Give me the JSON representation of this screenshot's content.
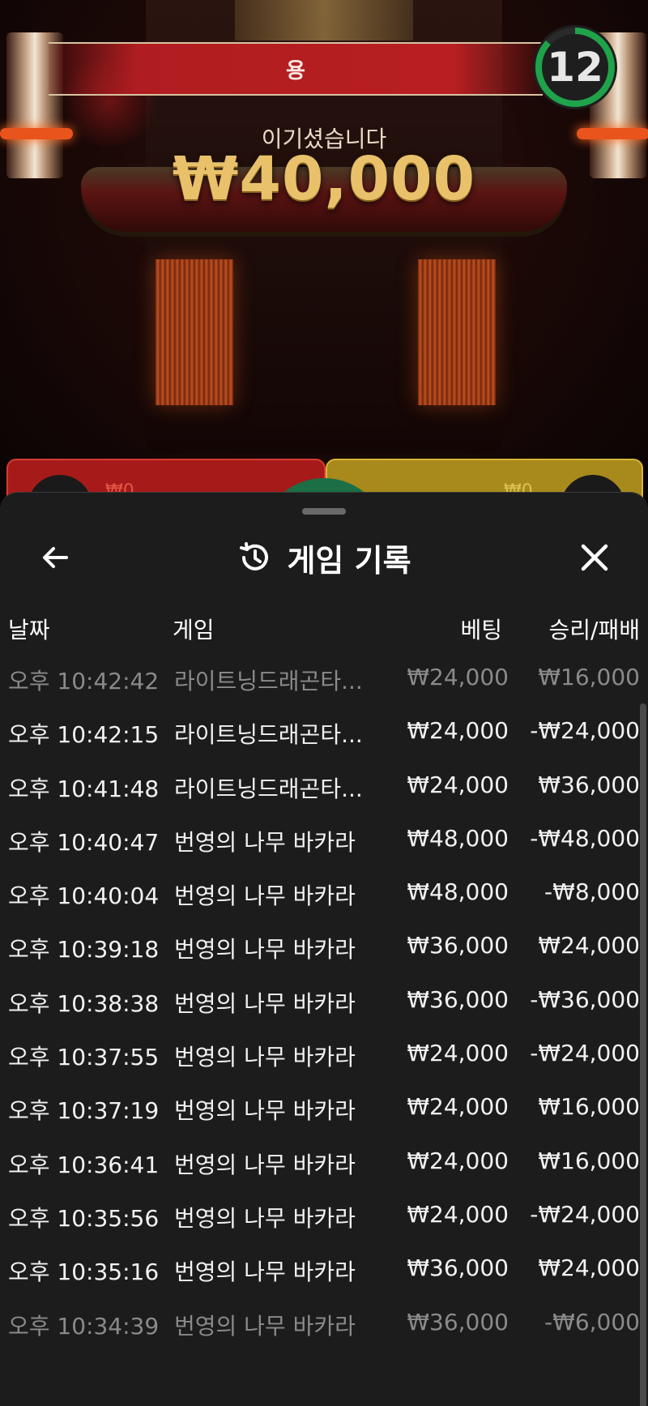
{
  "game_view": {
    "banner_label": "용",
    "timer_value": "12",
    "win_message": "이기셨습니다",
    "win_amount": "₩40,000",
    "red_bet": "₩0",
    "gold_bet": "₩0"
  },
  "sheet": {
    "title": "게임 기록",
    "columns": {
      "date": "날짜",
      "game": "게임",
      "bet": "베팅",
      "result": "승리/패배"
    },
    "rows": [
      {
        "date": "오후 10:42:42",
        "game": "라이트닝드래곤타...",
        "bet": "₩24,000",
        "result": "₩16,000"
      },
      {
        "date": "오후 10:42:15",
        "game": "라이트닝드래곤타...",
        "bet": "₩24,000",
        "result": "-₩24,000"
      },
      {
        "date": "오후 10:41:48",
        "game": "라이트닝드래곤타...",
        "bet": "₩24,000",
        "result": "₩36,000"
      },
      {
        "date": "오후 10:40:47",
        "game": "번영의 나무 바카라",
        "bet": "₩48,000",
        "result": "-₩48,000"
      },
      {
        "date": "오후 10:40:04",
        "game": "번영의 나무 바카라",
        "bet": "₩48,000",
        "result": "-₩8,000"
      },
      {
        "date": "오후 10:39:18",
        "game": "번영의 나무 바카라",
        "bet": "₩36,000",
        "result": "₩24,000"
      },
      {
        "date": "오후 10:38:38",
        "game": "번영의 나무 바카라",
        "bet": "₩36,000",
        "result": "-₩36,000"
      },
      {
        "date": "오후 10:37:55",
        "game": "번영의 나무 바카라",
        "bet": "₩24,000",
        "result": "-₩24,000"
      },
      {
        "date": "오후 10:37:19",
        "game": "번영의 나무 바카라",
        "bet": "₩24,000",
        "result": "₩16,000"
      },
      {
        "date": "오후 10:36:41",
        "game": "번영의 나무 바카라",
        "bet": "₩24,000",
        "result": "₩16,000"
      },
      {
        "date": "오후 10:35:56",
        "game": "번영의 나무 바카라",
        "bet": "₩24,000",
        "result": "-₩24,000"
      },
      {
        "date": "오후 10:35:16",
        "game": "번영의 나무 바카라",
        "bet": "₩36,000",
        "result": "₩24,000"
      },
      {
        "date": "오후 10:34:39",
        "game": "번영의 나무 바카라",
        "bet": "₩36,000",
        "result": "-₩6,000"
      }
    ]
  },
  "icons": {
    "back": "arrow-left-icon",
    "history": "history-clock-icon",
    "close": "close-x-icon"
  },
  "colors": {
    "sheet_bg": "#1c1c1c",
    "timer_ring": "#1fa34a",
    "banner_red": "#b81f22",
    "win_gold": "#e8c16a"
  }
}
